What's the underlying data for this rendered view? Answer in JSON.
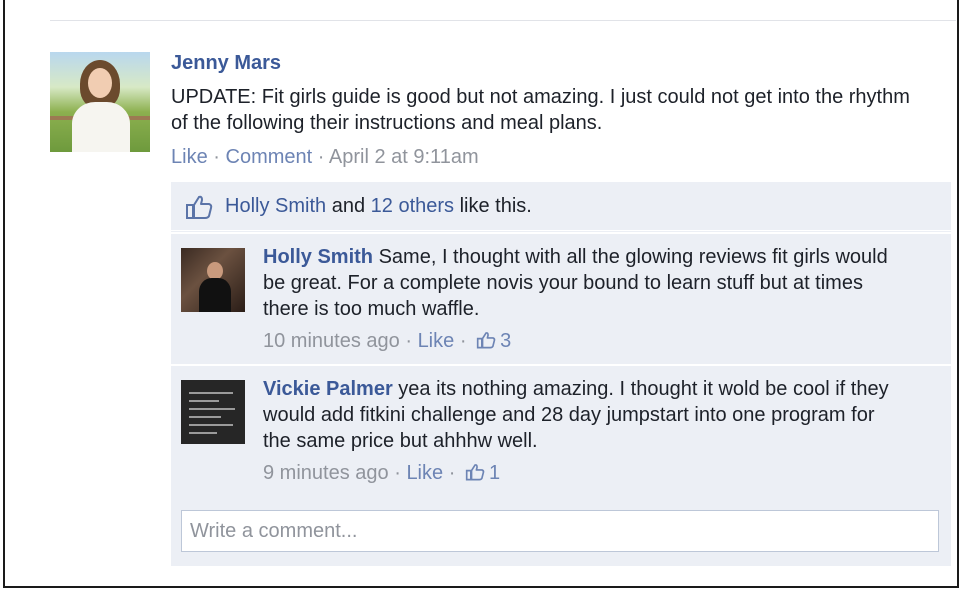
{
  "post": {
    "author": "Jenny Mars",
    "text": "UPDATE: Fit girls guide is good but not amazing. I just could not get into the rhythm of the following their instructions and meal plans.",
    "like_label": "Like",
    "comment_label": "Comment",
    "timestamp": "April 2 at 9:11am",
    "separator": "·"
  },
  "likes": {
    "first_liker": "Holly Smith",
    "and_text": "and",
    "others_link": "12 others",
    "suffix": "like this."
  },
  "comments": [
    {
      "author": "Holly Smith",
      "text": "Same, I thought with all the glowing reviews fit girls would be great. For a complete novis your bound to learn stuff but at times there is too much waffle.",
      "time": "10 minutes ago",
      "like_label": "Like",
      "like_count": "3"
    },
    {
      "author": "Vickie Palmer",
      "text": "yea its nothing amazing. I thought it wold be cool if they would add fitkini challenge and 28 day jumpstart into one program for the same price but ahhhw well.",
      "time": "9 minutes ago",
      "like_label": "Like",
      "like_count": "1"
    }
  ],
  "composer": {
    "placeholder": "Write a comment..."
  },
  "icons": {
    "like": "thumbs-up-icon"
  },
  "colors": {
    "link": "#3b5998",
    "meta": "#90949c",
    "panel": "#eceff5"
  }
}
